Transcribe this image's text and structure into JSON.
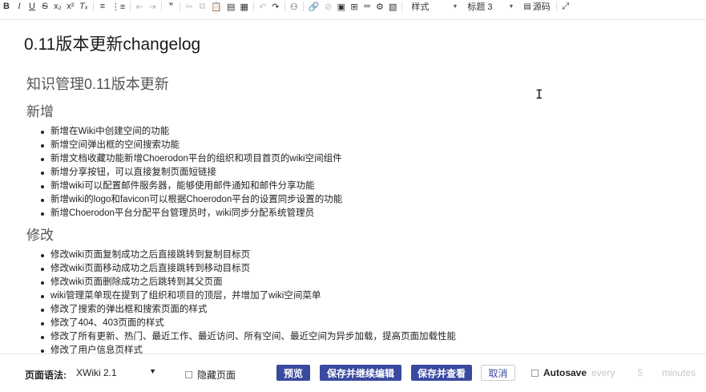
{
  "toolbar": {
    "style_combo": "样式",
    "heading_combo": "标题 3",
    "source_label": "源码"
  },
  "document": {
    "title": "0.11版本更新changelog",
    "main_heading": "知识管理0.11版本更新",
    "sections": [
      {
        "heading": "新增",
        "items": [
          "新增在Wiki中创建空间的功能",
          "新增空间弹出框的空间搜索功能",
          "新增文档收藏功能新增Choerodon平台的组织和项目首页的wiki空间组件",
          "新增分享按钮，可以直接复制页面短链接",
          "新增wiki可以配置邮件服务器，能够使用邮件通知和邮件分享功能",
          "新增wiki的logo和favicon可以根据Choerodon平台的设置同步设置的功能",
          "新增Choerodon平台分配平台管理员时，wiki同步分配系统管理员"
        ]
      },
      {
        "heading": "修改",
        "items": [
          "修改wiki页面复制成功之后直接跳转到复制目标页",
          "修改wiki页面移动成功之后直接跳转到移动目标页",
          "修改wiki页面删除成功之后跳转到其父页面",
          "wiki管理菜单现在提到了组织和项目的顶层，并增加了wiki空间菜单",
          "修改了搜索的弹出框和搜索页面的样式",
          "修改了404、403页面的样式",
          "修改了所有更新、热门、最近工作、最近访问、所有空间、最近空间为异步加载，提高页面加载性能",
          "修改了用户信息页样式"
        ]
      }
    ]
  },
  "bottombar": {
    "syntax_label": "页面语法:",
    "syntax_value": "XWiki 2.1",
    "hide_page_label": "隐藏页面",
    "preview_label": "预览",
    "save_continue_label": "保存并继续编辑",
    "save_view_label": "保存并查看",
    "cancel_label": "取消",
    "autosave_label": "Autosave",
    "autosave_every": "every",
    "autosave_minutes_value": "5",
    "autosave_minutes_label": "minutes"
  },
  "colors": {
    "primary_button": "#3a4aa0",
    "heading_gray": "#555555"
  }
}
